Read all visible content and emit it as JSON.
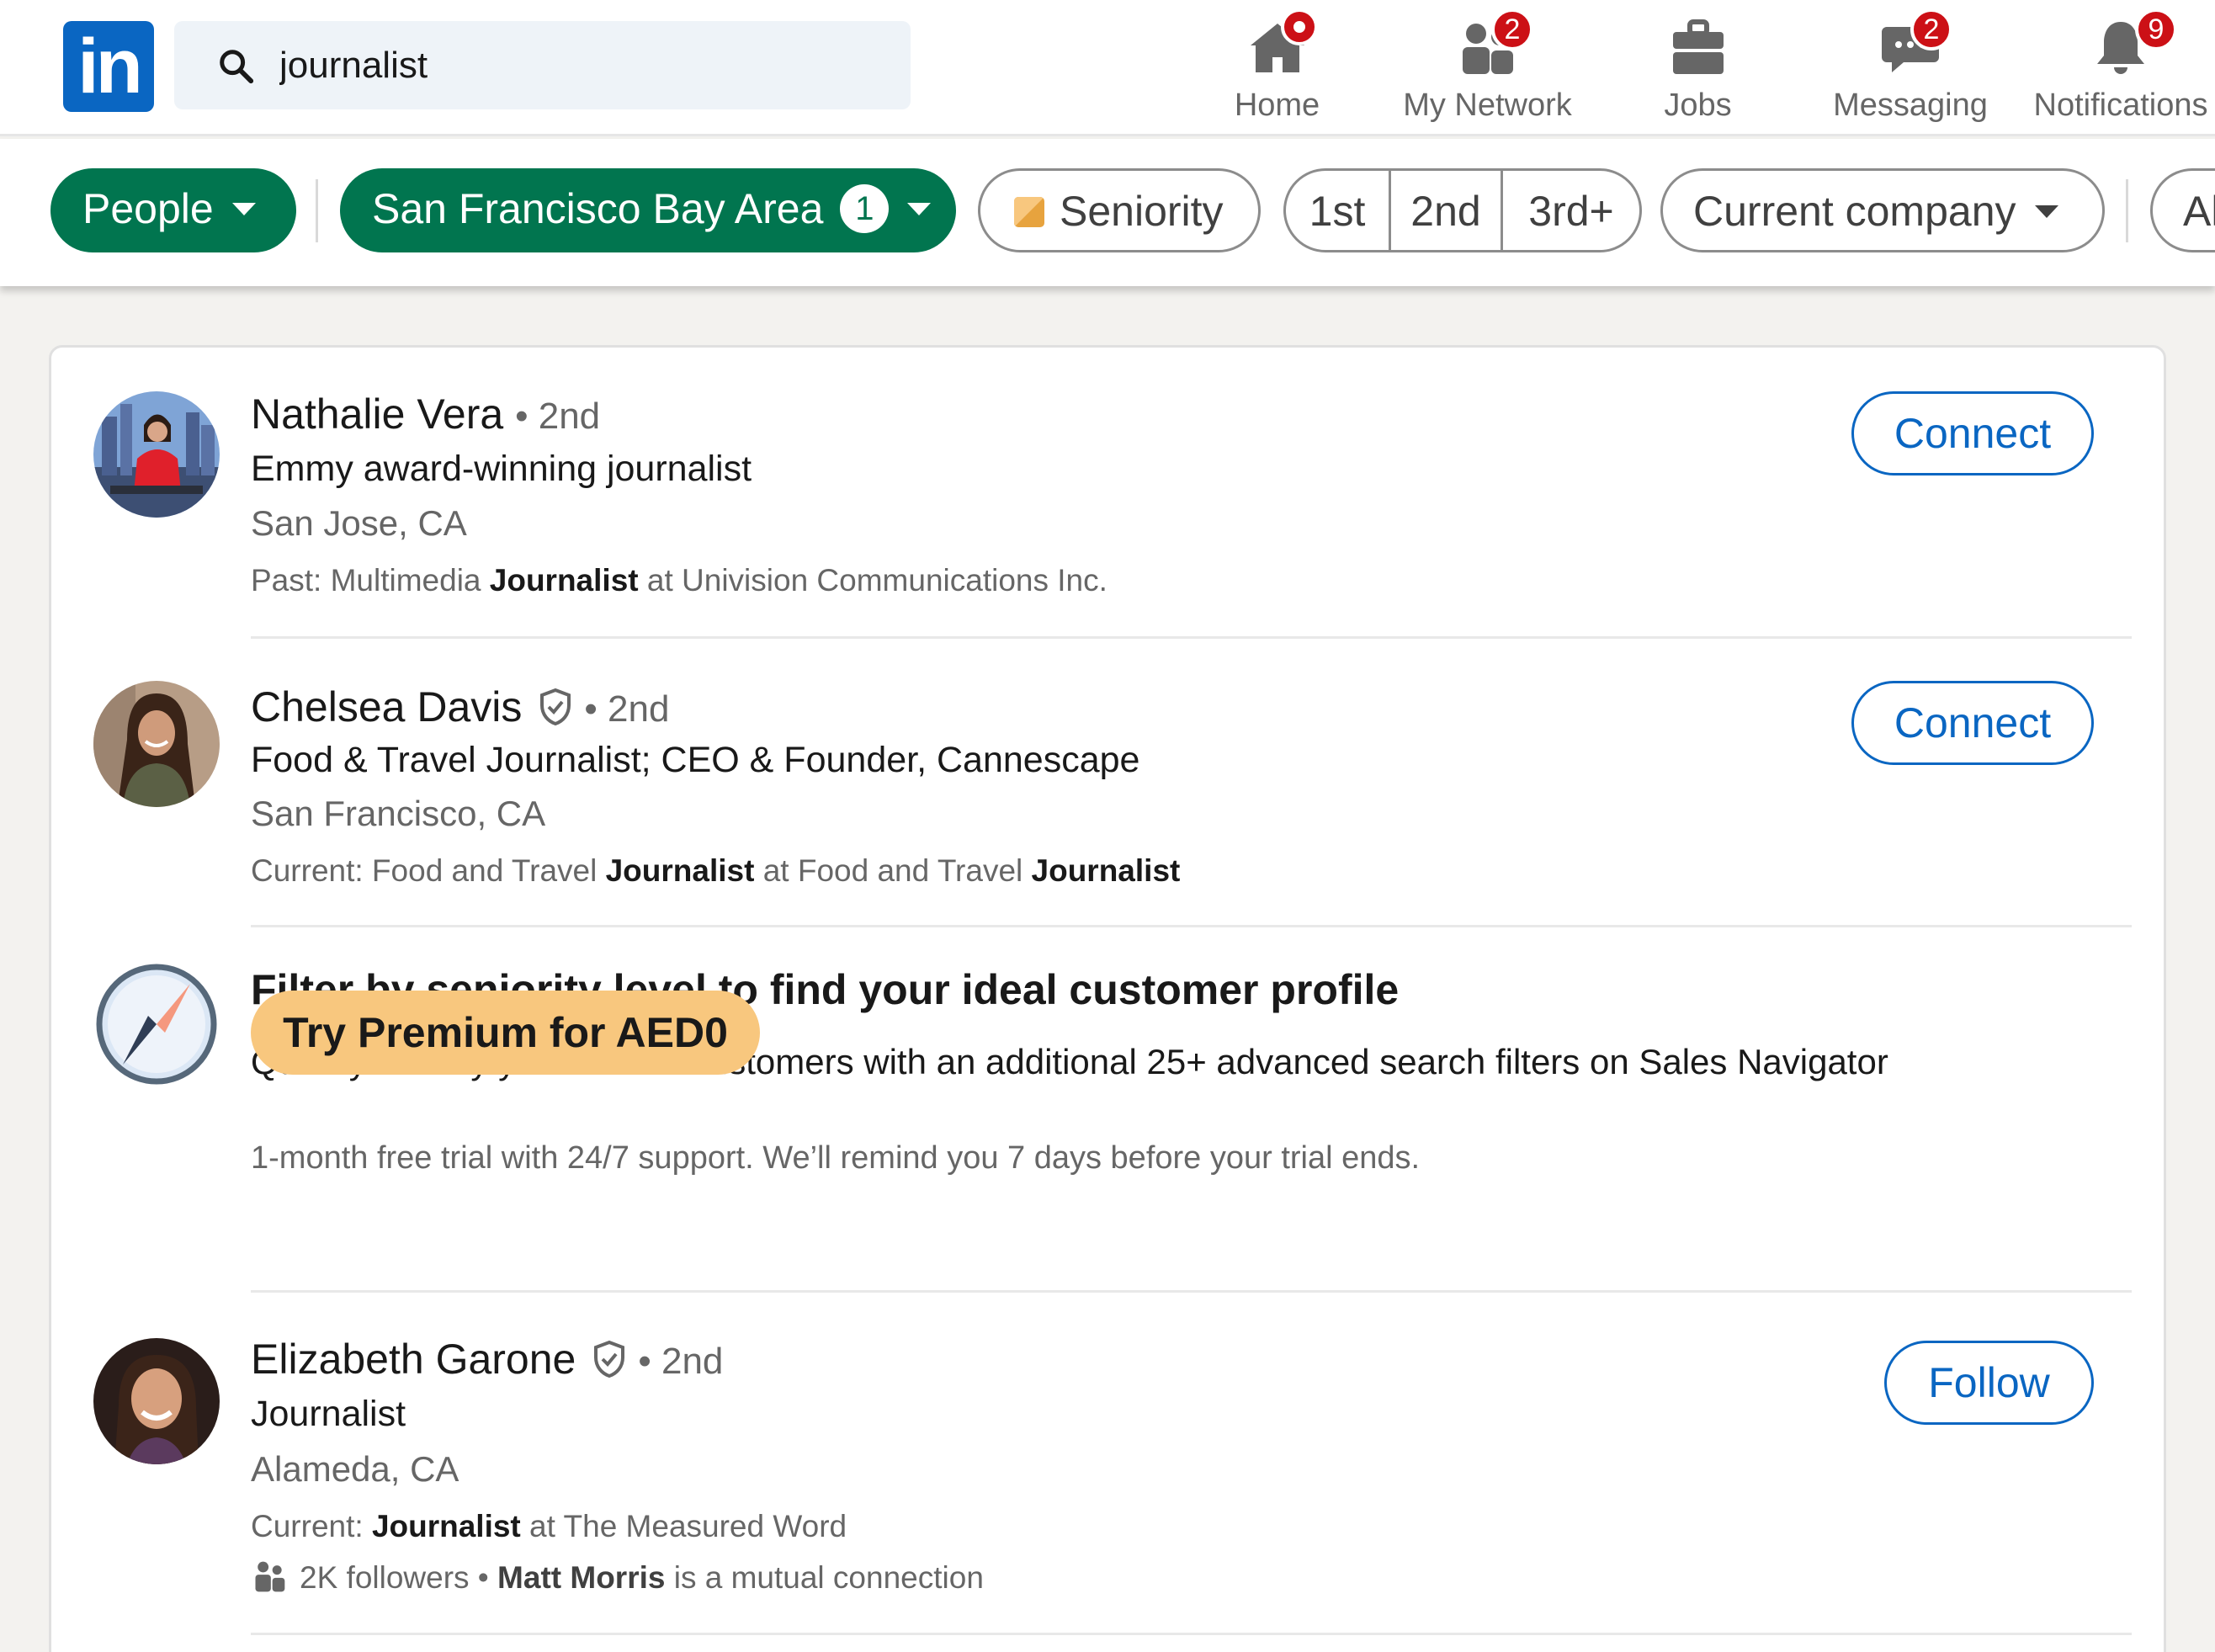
{
  "search": {
    "value": "journalist"
  },
  "nav": {
    "home": {
      "label": "Home"
    },
    "network": {
      "label": "My Network",
      "badge": "2"
    },
    "jobs": {
      "label": "Jobs"
    },
    "messaging": {
      "label": "Messaging",
      "badge": "2"
    },
    "notifications": {
      "label": "Notifications",
      "badge": "9"
    }
  },
  "filters": {
    "people": "People",
    "location": "San Francisco Bay Area",
    "location_count": "1",
    "seniority": "Seniority",
    "degrees": [
      "1st",
      "2nd",
      "3rd+"
    ],
    "company": "Current company",
    "more": "Al"
  },
  "results": [
    {
      "name": "Nathalie Vera",
      "degree": "• 2nd",
      "headline": "Emmy award-winning journalist",
      "location": "San Jose, CA",
      "summary": {
        "prefix": "Past: Multimedia ",
        "bold1": "Journalist",
        "middle": " at Univision Communications Inc.",
        "bold2": ""
      },
      "action": "Connect"
    },
    {
      "name": "Chelsea Davis",
      "degree": "• 2nd",
      "headline": "Food & Travel Journalist; CEO & Founder, Cannescape",
      "location": "San Francisco, CA",
      "summary": {
        "prefix": "Current: Food and Travel ",
        "bold1": "Journalist",
        "middle": " at Food and Travel ",
        "bold2": "Journalist"
      },
      "action": "Connect"
    },
    {
      "name": "Elizabeth Garone",
      "degree": "• 2nd",
      "headline": "Journalist",
      "location": "Alameda, CA",
      "summary": {
        "prefix": "Current: ",
        "bold1": "Journalist",
        "middle": " at The Measured Word",
        "bold2": ""
      },
      "followers": "2K followers •",
      "mutual_name": "Matt Morris",
      "mutual_text": "is a mutual connection",
      "action": "Follow"
    }
  ],
  "promo": {
    "title": "Filter by seniority level to find your ideal customer profile",
    "text": "Quickly identify your best fit customers with an additional 25+ advanced search filters on Sales Navigator",
    "button": "Try Premium for AED0",
    "note": "1-month free trial with 24/7 support. We’ll remind you 7 days before your trial ends."
  },
  "colors": {
    "brand": "#0a66c2",
    "filter_active": "#01754f",
    "badge": "#cc1016",
    "premium": "#f8c77e"
  }
}
